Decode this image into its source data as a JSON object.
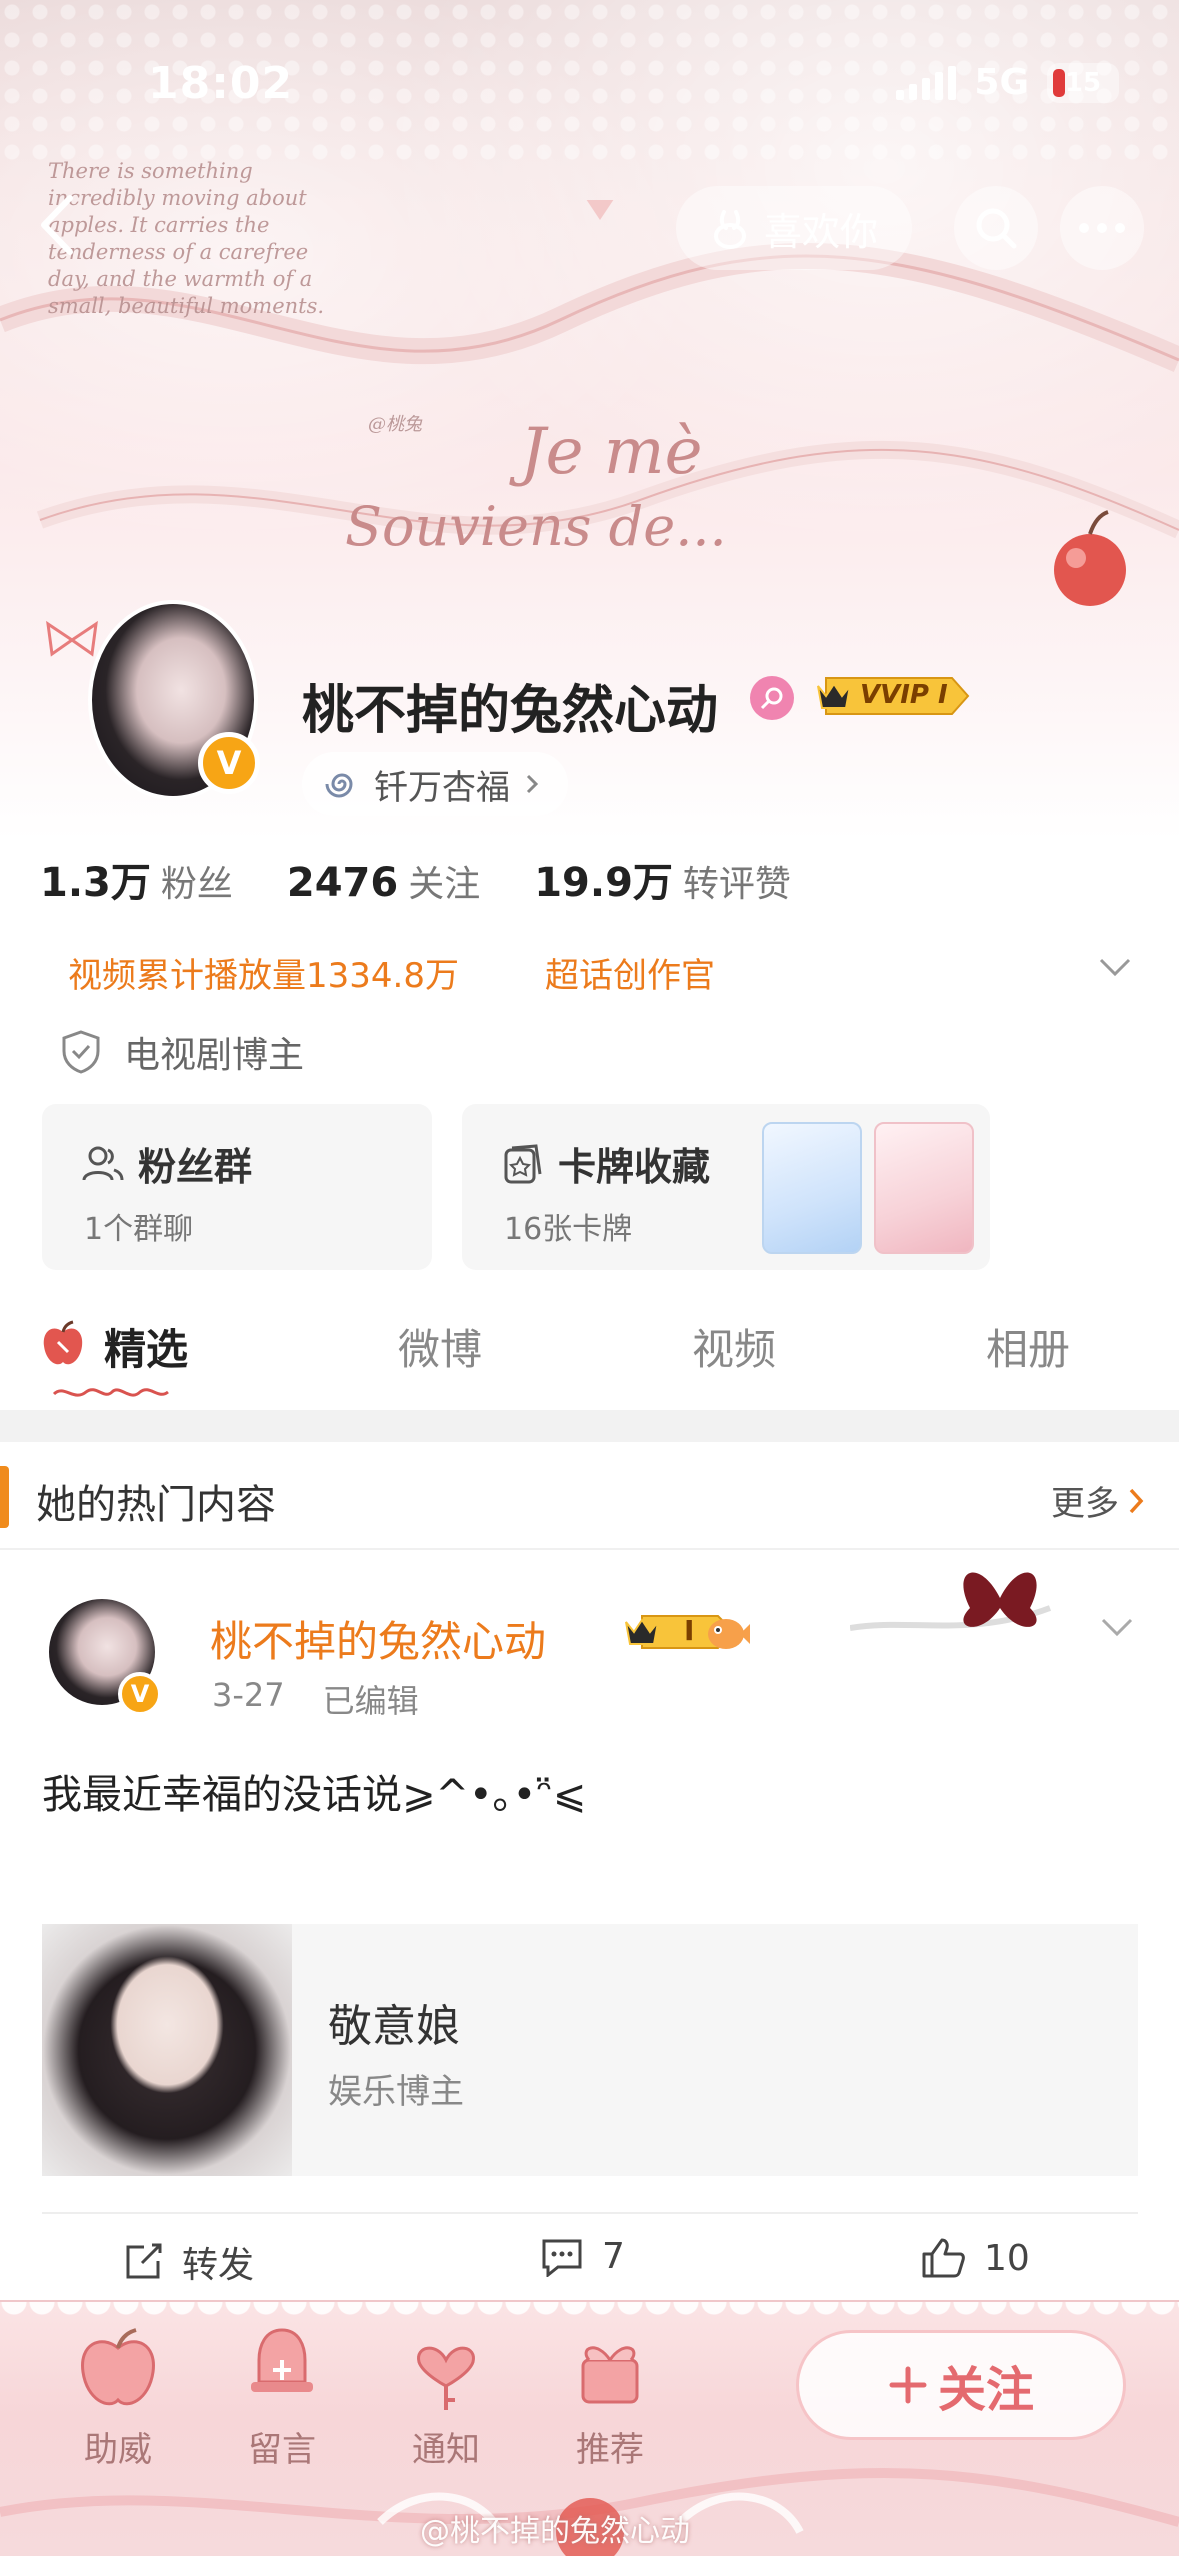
{
  "status_bar": {
    "time": "18:02",
    "network": "5G",
    "battery": "15"
  },
  "top_nav": {
    "like_label": "喜欢你"
  },
  "banner": {
    "deco_small_text": "There is something incredibly moving about apples. It carries the tenderness of a carefree day, and the warmth of a small, beautiful moments.",
    "deco_tag": "@桃兔",
    "deco_je": "Je mè",
    "deco_souviens": "Souviens de..."
  },
  "profile": {
    "username": "桃不掉的兔然心动",
    "vvip_label": "VVIP I",
    "group_name": "钎万杏福",
    "v_badge": "V"
  },
  "stats": [
    {
      "num": "1.3万",
      "label": "粉丝"
    },
    {
      "num": "2476",
      "label": "关注"
    },
    {
      "num": "19.9万",
      "label": "转评赞"
    }
  ],
  "honors": [
    "视频累计播放量1334.8万",
    "超话创作官"
  ],
  "certification": "电视剧博主",
  "cards": {
    "fans_group": {
      "title": "粉丝群",
      "sub": "1个群聊"
    },
    "card_collection": {
      "title": "卡牌收藏",
      "sub": "16张卡牌"
    }
  },
  "tabs": [
    "精选",
    "微博",
    "视频",
    "相册"
  ],
  "hot": {
    "title": "她的热门内容",
    "more": "更多"
  },
  "post": {
    "author": "桃不掉的兔然心动",
    "crown_level": "I",
    "date": "3-27",
    "edited": "已编辑",
    "text": "我最近幸福的没话说⩾^•｡•ᵔ̈⩽",
    "shared_user": {
      "name": "敬意娘",
      "desc": "娱乐博主"
    },
    "actions": {
      "repost": "转发",
      "comments": "7",
      "likes": "10"
    }
  },
  "bottom_bar": {
    "items": [
      "助威",
      "留言",
      "通知",
      "推荐"
    ],
    "follow": "关注"
  },
  "watermark": "@桃不掉的兔然心动",
  "colors": {
    "accent_orange": "#ec7b1c",
    "vip_gold": "#f7a515",
    "follow_pink": "#e46a6f"
  }
}
